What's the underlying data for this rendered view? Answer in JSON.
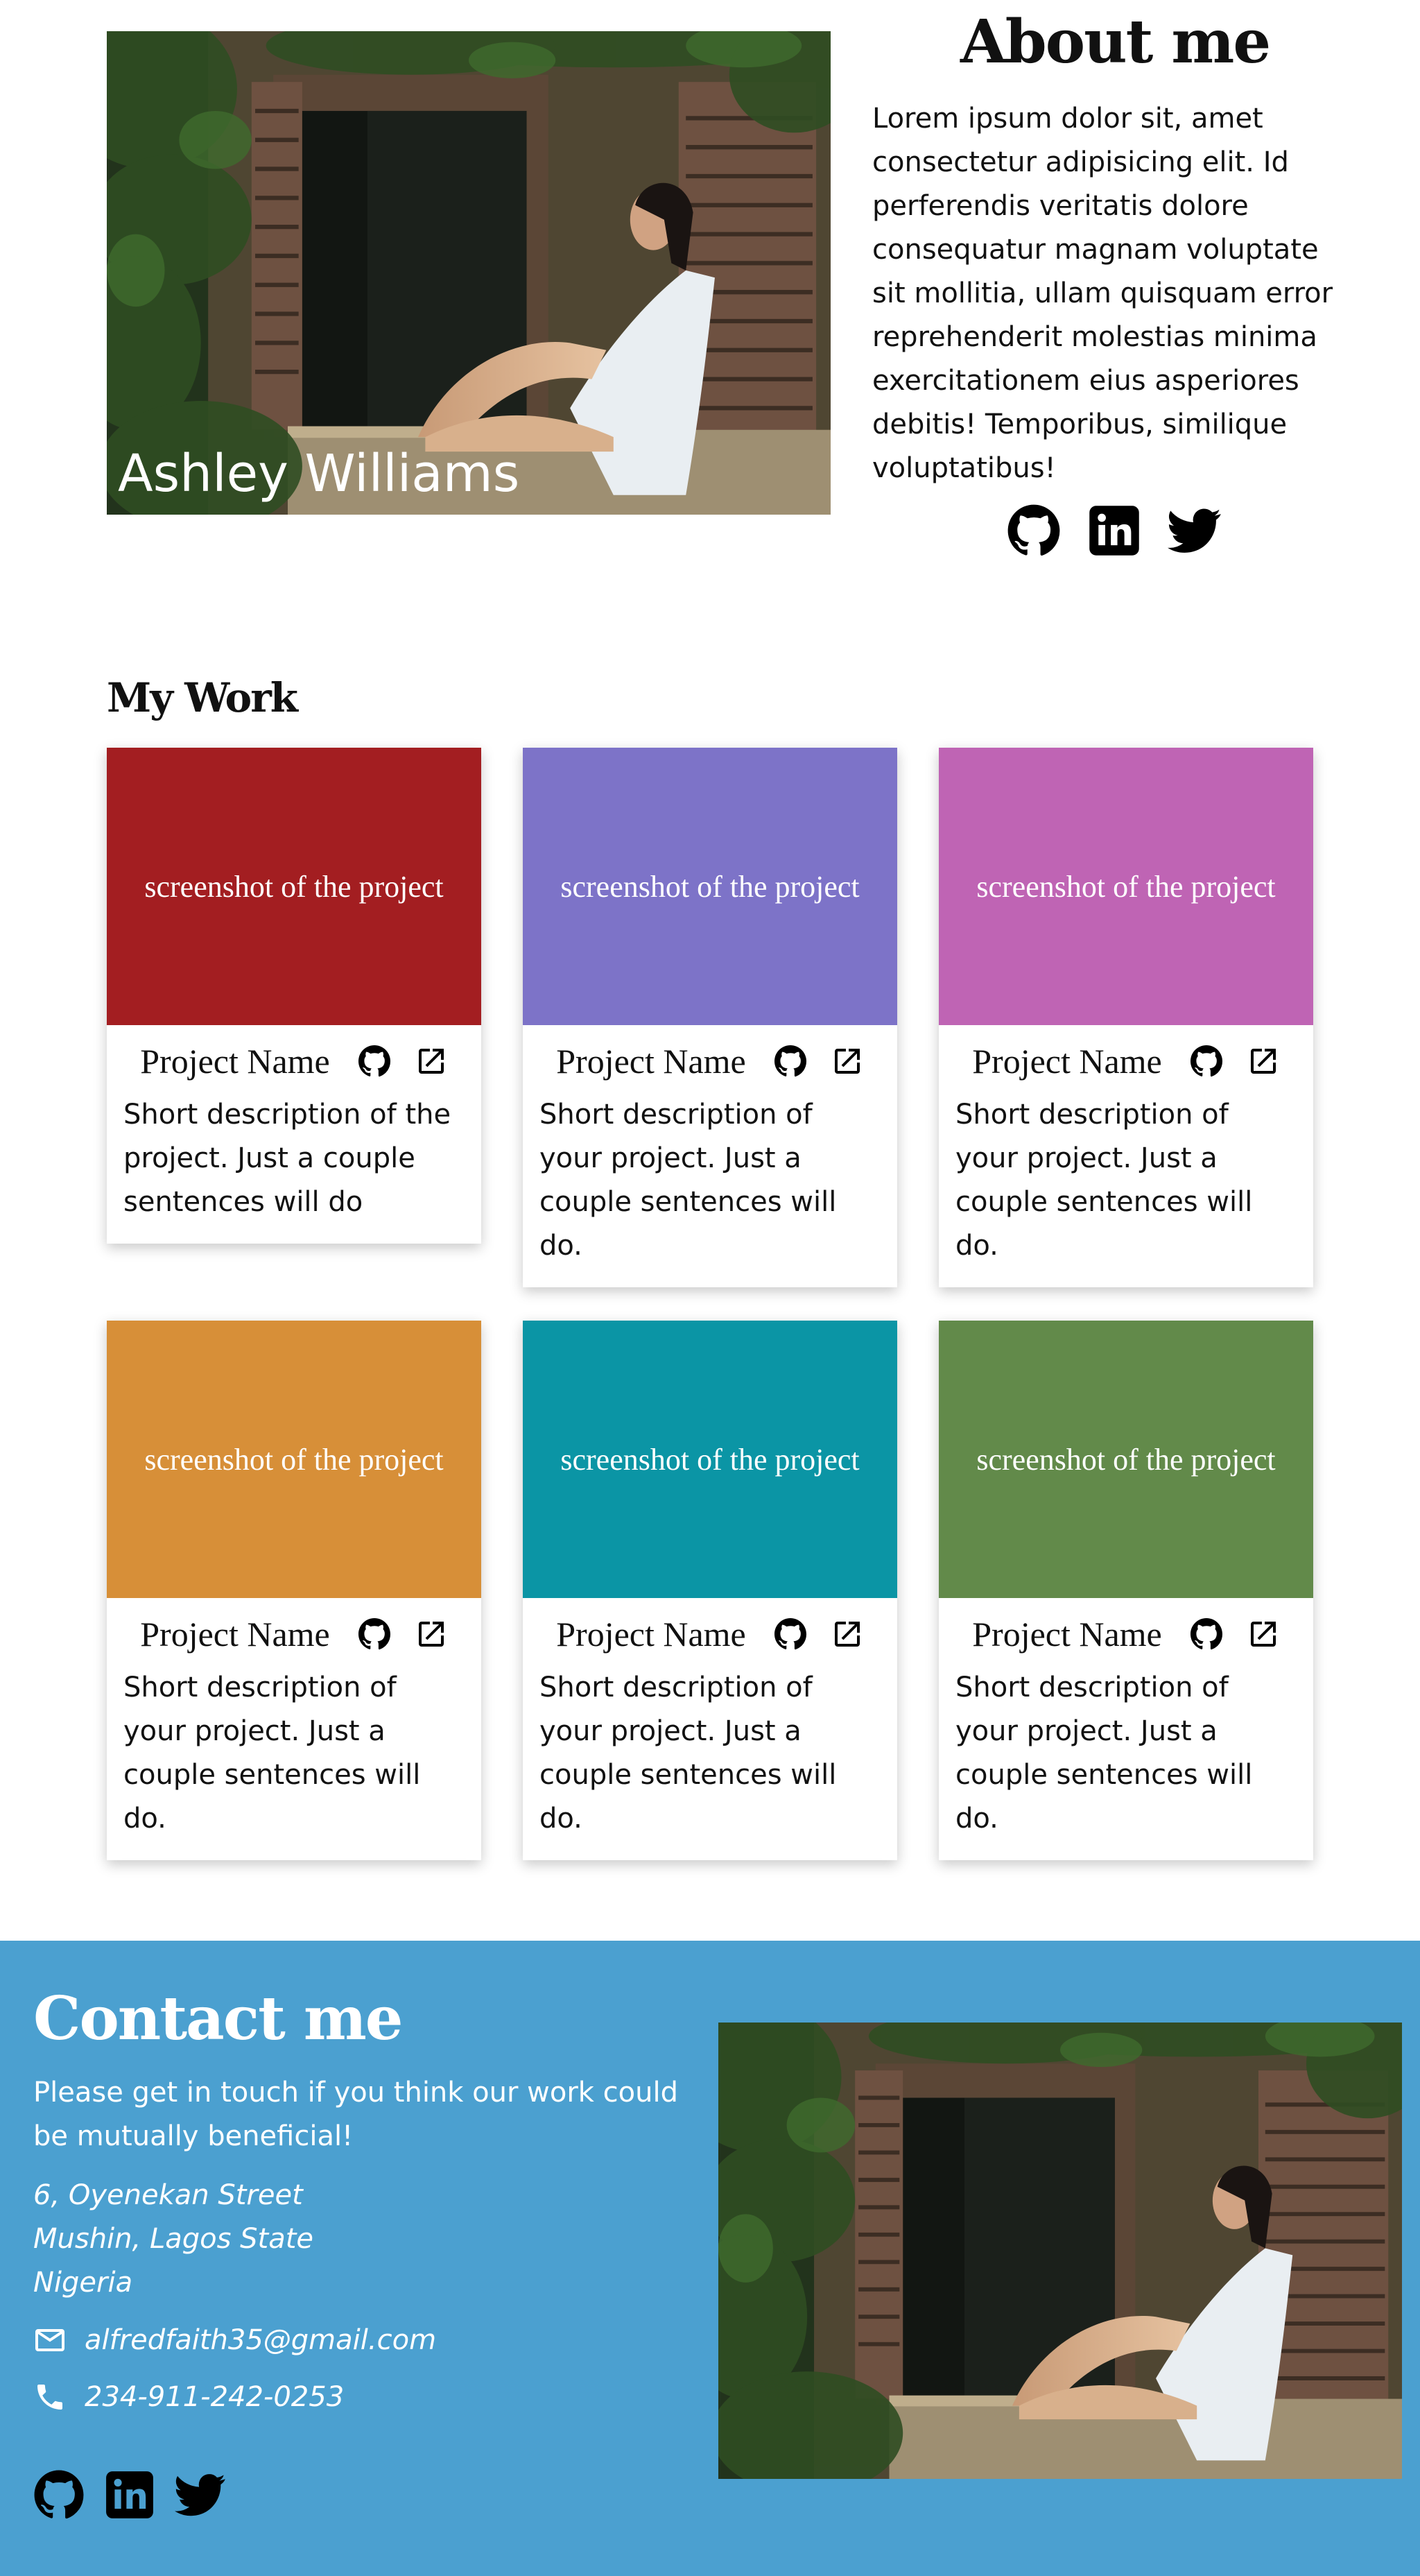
{
  "hero": {
    "name": "Ashley Williams",
    "about_title": "About me",
    "about_text": "Lorem ipsum dolor sit, amet consectetur adipisicing elit. Id perferendis veritatis dolore consequatur magnam voluptate sit mollitia, ullam quisquam error reprehenderit molestias minima exercitationem eius asperiores debitis! Temporibus, similique voluptatibus!",
    "social": [
      "github-icon",
      "linkedin-icon",
      "twitter-icon"
    ]
  },
  "work": {
    "title": "My Work",
    "projects": [
      {
        "shot": "screenshot of the project",
        "color": "#a31e21",
        "name": "Project Name",
        "desc": "Short description of the project. Just a couple sentences will do"
      },
      {
        "shot": "screenshot of the project",
        "color": "#7d73c8",
        "name": "Project Name",
        "desc": "Short description of your project. Just a couple sentences will do."
      },
      {
        "shot": "screenshot of the project",
        "color": "#bf64b4",
        "name": "Project Name",
        "desc": "Short description of your project. Just a couple sentences will do."
      },
      {
        "shot": "screenshot of the project",
        "color": "#d78f38",
        "name": "Project Name",
        "desc": "Short description of your project. Just a couple sentences will do."
      },
      {
        "shot": "screenshot of the project",
        "color": "#0b95a5",
        "name": "Project Name",
        "desc": "Short description of your project. Just a couple sentences will do."
      },
      {
        "shot": "screenshot of the project",
        "color": "#628a4a",
        "name": "Project Name",
        "desc": "Short description of your project. Just a couple sentences will do."
      }
    ]
  },
  "contact": {
    "title": "Contact me",
    "intro": "Please get in touch if you think our work could be mutually beneficial!",
    "address": [
      "6, Oyenekan Street",
      "Mushin, Lagos State",
      "Nigeria"
    ],
    "email": "alfredfaith35@gmail.com",
    "phone": "234-911-242-0253",
    "background": "#4ba0d0",
    "social": [
      "github-icon",
      "linkedin-icon",
      "twitter-icon"
    ]
  }
}
